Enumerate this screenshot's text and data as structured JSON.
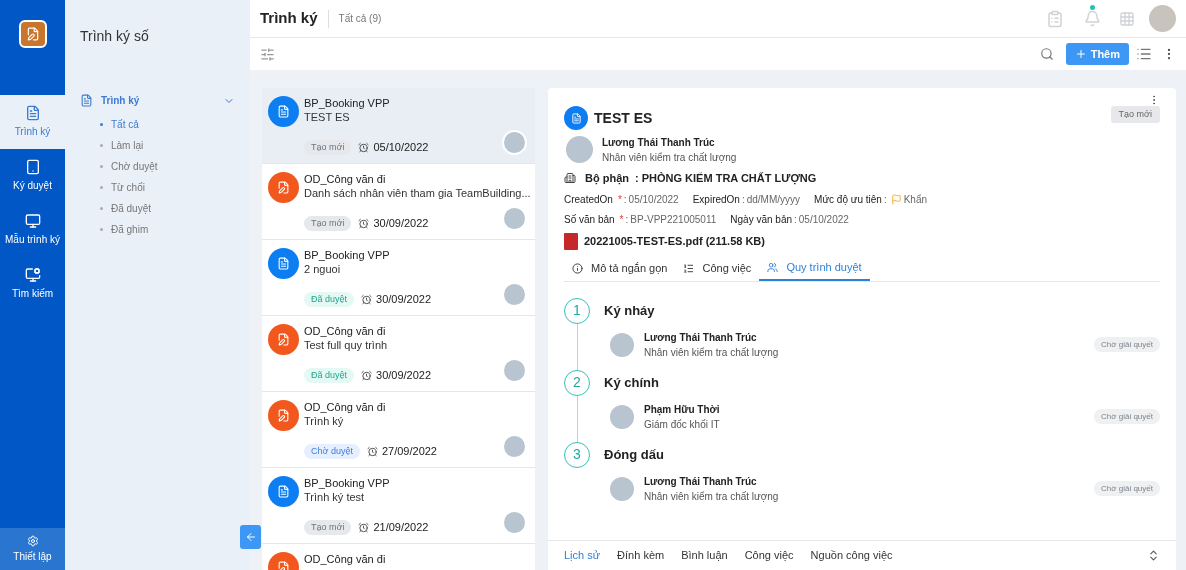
{
  "rail": {
    "items": [
      {
        "label": "Trình ký",
        "selected": true
      },
      {
        "label": "Ký duyệt",
        "selected": false
      },
      {
        "label": "Mẫu trình ký",
        "selected": false
      },
      {
        "label": "Tìm kiếm",
        "selected": false
      }
    ],
    "footer": {
      "label": "Thiết lập"
    }
  },
  "sidebar": {
    "title": "Trình ký số",
    "group": {
      "label": "Trình ký",
      "expanded": true,
      "items": [
        {
          "label": "Tất cả",
          "selected": true
        },
        {
          "label": "Làm lại",
          "selected": false
        },
        {
          "label": "Chờ duyệt",
          "selected": false
        },
        {
          "label": "Từ chối",
          "selected": false
        },
        {
          "label": "Đã duyệt",
          "selected": false
        },
        {
          "label": "Đã ghim",
          "selected": false
        }
      ]
    }
  },
  "header": {
    "title": "Trình ký",
    "count_label": "Tất cả (9)"
  },
  "toolbar": {
    "add_button": "Thêm"
  },
  "list": [
    {
      "kind": "booking",
      "category": "BP_Booking VPP",
      "title": "TEST ES",
      "status": {
        "kind": "new",
        "label": "Tạo mới"
      },
      "date": "05/10/2022",
      "selected": true
    },
    {
      "kind": "dispatch",
      "category": "OD_Công văn đi",
      "title": "Danh sách nhân viên tham gia TeamBuilding...",
      "status": {
        "kind": "new",
        "label": "Tạo mới"
      },
      "date": "30/09/2022",
      "selected": false
    },
    {
      "kind": "booking",
      "category": "BP_Booking VPP",
      "title": "2 nguoi",
      "status": {
        "kind": "approved",
        "label": "Đã duyệt"
      },
      "date": "30/09/2022",
      "selected": false
    },
    {
      "kind": "dispatch",
      "category": "OD_Công văn đi",
      "title": "Test full quy trình",
      "status": {
        "kind": "approved",
        "label": "Đã duyệt"
      },
      "date": "30/09/2022",
      "selected": false
    },
    {
      "kind": "dispatch",
      "category": "OD_Công văn đi",
      "title": "Trình ký",
      "status": {
        "kind": "pending",
        "label": "Chờ duyệt"
      },
      "date": "27/09/2022",
      "selected": false
    },
    {
      "kind": "booking",
      "category": "BP_Booking VPP",
      "title": "Trình ký test",
      "status": {
        "kind": "new",
        "label": "Tạo mới"
      },
      "date": "21/09/2022",
      "selected": false
    },
    {
      "kind": "dispatch",
      "category": "OD_Công văn đi",
      "selected": false
    }
  ],
  "detail": {
    "title": "TEST ES",
    "status": "Tạo mới",
    "author": {
      "name": "Lương Thái Thanh Trúc",
      "role": "Nhân viên kiểm tra chất lượng"
    },
    "department": {
      "label": "Bộ phận",
      "value": ": PHÒNG KIỂM TRA CHẤT LƯỢNG"
    },
    "field_rows": [
      [
        {
          "kind": "text",
          "label": "CreatedOn",
          "required_mark": "*",
          "separator": ":",
          "value": "05/10/2022"
        },
        {
          "kind": "text",
          "label": "ExpiredOn",
          "separator": ":",
          "value": "dd/MM/yyyy"
        },
        {
          "kind": "priority",
          "label": "Mức độ ưu tiên",
          "separator": ":",
          "value": "Khẩn"
        }
      ],
      [
        {
          "kind": "text",
          "label": "Số văn bản",
          "required_mark": "*",
          "separator": ":",
          "value": "BP-VPP221005011"
        },
        {
          "kind": "text",
          "label": "Ngày văn bản",
          "separator": ":",
          "value": "05/10/2022"
        }
      ]
    ],
    "attachment": "20221005-TEST-ES.pdf (211.58 KB)",
    "tabs": [
      {
        "label": "Mô tả ngắn gọn",
        "selected": false
      },
      {
        "label": "Công việc",
        "selected": false
      },
      {
        "label": "Quy trình duyệt",
        "selected": true
      }
    ],
    "steps": [
      {
        "number": "1",
        "title": "Ký nháy",
        "assignees": [
          {
            "name": "Lương Thái Thanh Trúc",
            "role": "Nhân viên kiểm tra chất lượng",
            "status": "Chờ giải quyết"
          }
        ]
      },
      {
        "number": "2",
        "title": "Ký chính",
        "assignees": [
          {
            "name": "Phạm Hữu Thời",
            "role": "Giám đốc khối IT",
            "status": "Chờ giải quyết"
          }
        ]
      },
      {
        "number": "3",
        "title": "Đóng dấu",
        "assignees": [
          {
            "name": "Lương Thái Thanh Trúc",
            "role": "Nhân viên kiểm tra chất lượng",
            "status": "Chờ giải quyết"
          }
        ]
      }
    ],
    "bottom_tabs": [
      {
        "label": "Lịch sử",
        "selected": true
      },
      {
        "label": "Đính kèm",
        "selected": false
      },
      {
        "label": "Bình luận",
        "selected": false
      },
      {
        "label": "Công việc",
        "selected": false
      },
      {
        "label": "Nguồn công việc",
        "selected": false
      }
    ]
  }
}
